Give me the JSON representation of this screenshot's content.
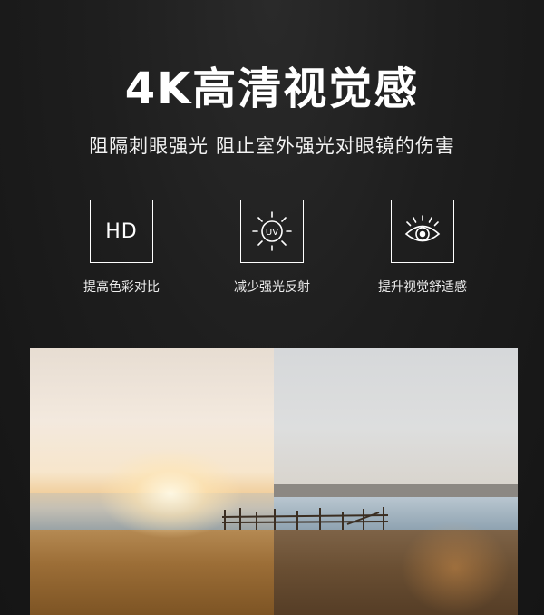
{
  "title": "4K高清视觉感",
  "subtitle": "阻隔刺眼强光 阻止室外强光对眼镜的伤害",
  "features": [
    {
      "icon": "hd-icon",
      "icon_text": "HD",
      "label": "提高色彩对比"
    },
    {
      "icon": "uv-sun-icon",
      "icon_text": "UV",
      "label": "减少强光反射"
    },
    {
      "icon": "eye-icon",
      "icon_text": "",
      "label": "提升视觉舒适感"
    }
  ],
  "photo": {
    "description_hidden": ""
  }
}
